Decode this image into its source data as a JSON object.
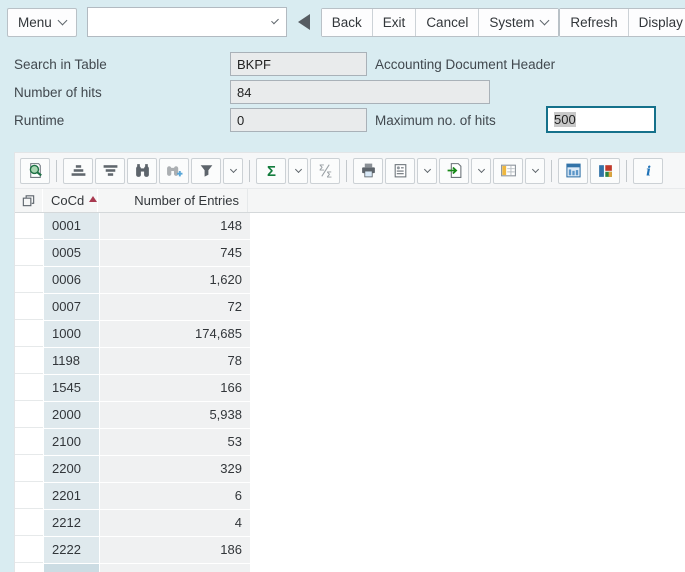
{
  "colors": {
    "page_bg": "#d9ecf1",
    "focus_border": "#15718b",
    "sort_arrow": "#a8394f",
    "sum_green": "#137c3d",
    "info_blue": "#2073b8",
    "cocd_cell_bg": "#dfe9ed",
    "value_cell_bg": "#f0f1f2"
  },
  "top_toolbar": {
    "menu": "Menu",
    "command_value": "",
    "nav_buttons": [
      "Back",
      "Exit",
      "Cancel"
    ],
    "system": "System",
    "app_buttons": [
      "Refresh",
      "Display Selection"
    ]
  },
  "form": {
    "search_label": "Search in Table",
    "search_value": "BKPF",
    "search_desc": "Accounting Document Header",
    "hits_label": "Number of hits",
    "hits_value": "84",
    "runtime_label": "Runtime",
    "runtime_value": "0",
    "max_label": "Maximum no. of hits",
    "max_value": "500"
  },
  "alv_toolbar": {
    "buttons": [
      {
        "icon": "details"
      },
      {
        "separator": true
      },
      {
        "icon": "sort-ascending"
      },
      {
        "icon": "sort-descending"
      },
      {
        "icon": "find"
      },
      {
        "icon": "find-next",
        "disabled": true
      },
      {
        "icon": "filter",
        "dropdown": true
      },
      {
        "separator": true
      },
      {
        "icon": "sum",
        "dropdown": true
      },
      {
        "icon": "subtotals",
        "disabled": true
      },
      {
        "separator": true
      },
      {
        "icon": "print"
      },
      {
        "icon": "views",
        "dropdown": true
      },
      {
        "icon": "export",
        "dropdown": true
      },
      {
        "icon": "layout",
        "dropdown": true
      },
      {
        "separator": true
      },
      {
        "icon": "graphic"
      },
      {
        "icon": "chart"
      },
      {
        "separator": true
      },
      {
        "icon": "info"
      }
    ]
  },
  "table": {
    "columns": [
      {
        "label": "CoCd",
        "sorted": "ascending"
      },
      {
        "label": "Number of Entries"
      }
    ],
    "rows": [
      {
        "cocd": "0001",
        "entries": "148"
      },
      {
        "cocd": "0005",
        "entries": "745"
      },
      {
        "cocd": "0006",
        "entries": "1,620"
      },
      {
        "cocd": "0007",
        "entries": "72"
      },
      {
        "cocd": "1000",
        "entries": "174,685"
      },
      {
        "cocd": "1198",
        "entries": "78"
      },
      {
        "cocd": "1545",
        "entries": "166"
      },
      {
        "cocd": "2000",
        "entries": "5,938"
      },
      {
        "cocd": "2100",
        "entries": "53"
      },
      {
        "cocd": "2200",
        "entries": "329"
      },
      {
        "cocd": "2201",
        "entries": "6"
      },
      {
        "cocd": "2212",
        "entries": "4"
      },
      {
        "cocd": "2222",
        "entries": "186"
      }
    ]
  }
}
